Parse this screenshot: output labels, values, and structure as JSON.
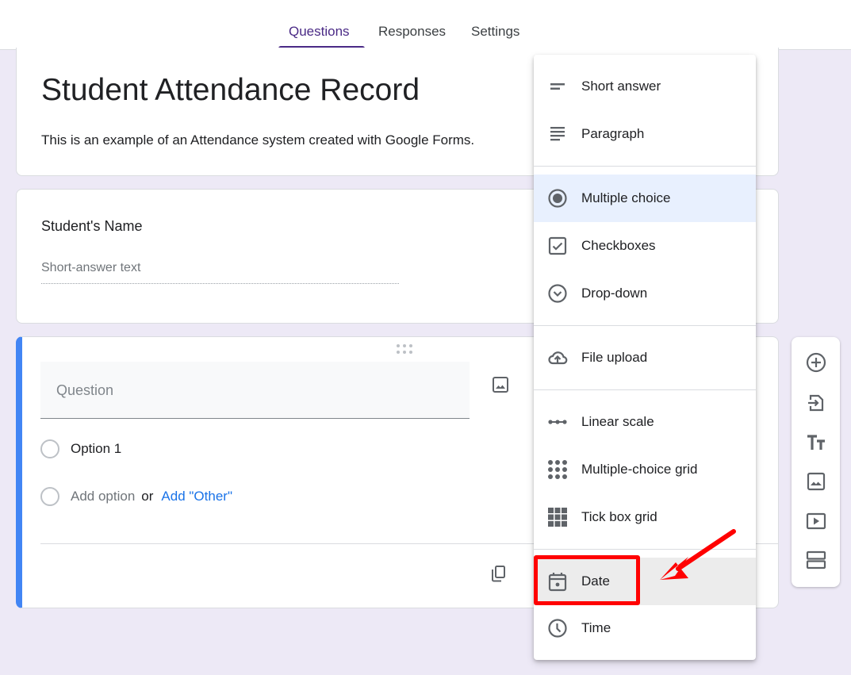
{
  "tabs": [
    {
      "label": "Questions",
      "active": true
    },
    {
      "label": "Responses",
      "active": false
    },
    {
      "label": "Settings",
      "active": false
    }
  ],
  "form": {
    "title": "Student Attendance Record",
    "description": "This is an example of an Attendance system created with Google Forms."
  },
  "name_question": {
    "label": "Student's Name",
    "placeholder": "Short-answer text"
  },
  "new_question": {
    "placeholder": "Question",
    "options": [
      "Option 1"
    ],
    "add_option": "Add option",
    "or": "or",
    "add_other": "Add \"Other\""
  },
  "type_menu": {
    "items": [
      {
        "label": "Short answer",
        "icon": "short-answer-icon"
      },
      {
        "label": "Paragraph",
        "icon": "paragraph-icon"
      },
      {
        "label": "Multiple choice",
        "icon": "radio-button-icon",
        "selected": true
      },
      {
        "label": "Checkboxes",
        "icon": "checkbox-icon"
      },
      {
        "label": "Drop-down",
        "icon": "dropdown-circle-icon"
      },
      {
        "label": "File upload",
        "icon": "cloud-upload-icon"
      },
      {
        "label": "Linear scale",
        "icon": "linear-scale-icon"
      },
      {
        "label": "Multiple-choice grid",
        "icon": "dot-grid-icon"
      },
      {
        "label": "Tick box grid",
        "icon": "box-grid-icon"
      },
      {
        "label": "Date",
        "icon": "calendar-icon",
        "hovered": true
      },
      {
        "label": "Time",
        "icon": "clock-icon"
      }
    ]
  },
  "toolbar": {
    "buttons": [
      "add-question",
      "import-questions",
      "add-title-description",
      "add-image",
      "add-video",
      "add-section"
    ]
  },
  "annotation": {
    "highlight_color": "#ff0000",
    "target": "Date"
  },
  "colors": {
    "accent": "#4a2a86",
    "active_question_border": "#4285f4",
    "background": "#ede9f6",
    "link": "#1a73e8"
  }
}
